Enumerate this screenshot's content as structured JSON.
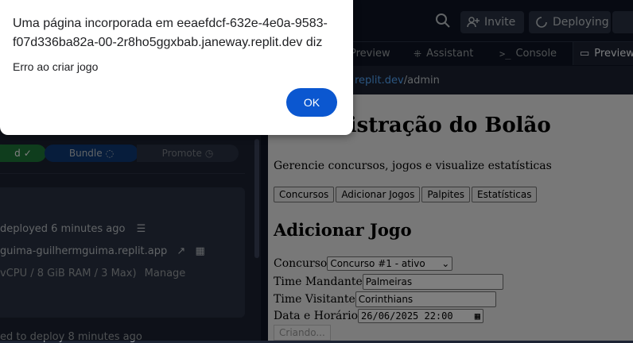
{
  "header": {
    "invite_label": "Invite",
    "deploying_label": "Deploying"
  },
  "tabs": [
    {
      "label": "Preview"
    },
    {
      "label": "Assistant"
    },
    {
      "label": "Console"
    },
    {
      "label": "Preview"
    }
  ],
  "url": {
    "domain": "replit.dev",
    "path": "/admin"
  },
  "preview": {
    "title": "Administração do Bolão",
    "subtitle": "Gerencie concursos, jogos e visualize estatísticas",
    "nav": [
      "Concursos",
      "Adicionar Jogos",
      "Palpites",
      "Estatísticas"
    ],
    "section_title": "Adicionar Jogo",
    "form": {
      "concurso_label": "Concurso",
      "concurso_value": "Concurso #1 - ativo",
      "mandante_label": "Time Mandante",
      "mandante_value": "Palmeiras",
      "visitante_label": "Time Visitante",
      "visitante_value": "Corinthians",
      "datetime_label": "Data e Horário",
      "datetime_value": "26/06/2025 22:00",
      "submit_label": "Criando..."
    }
  },
  "deploy": {
    "steps": [
      "d",
      "Bundle",
      "Promote"
    ],
    "deployed_text": "deployed 6 minutes ago",
    "domain_text": "guima-guilhermguima.replit.app",
    "resources_text": "vCPU / 8 GiB RAM / 3 Max)",
    "manage_label": "Manage",
    "failed_text": "ed to deploy 8 minutes ago"
  },
  "dialog": {
    "message": "Uma página incorporada em eeaefdcf-632e-4e0a-9583-f07d336ba82a-00-2r8ho5ggxbab.janeway.replit.dev diz",
    "body": "Erro ao criar jogo",
    "ok_label": "OK"
  },
  "colors": {
    "accent": "#0b57d0",
    "success": "#1f7a3a",
    "link": "#57abff"
  }
}
